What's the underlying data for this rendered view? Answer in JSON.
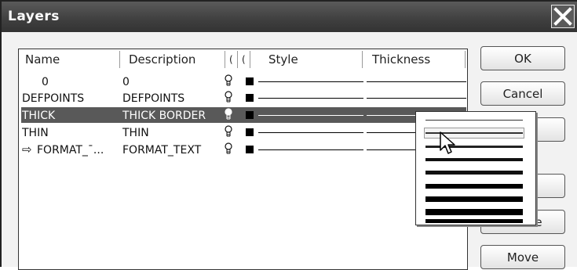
{
  "window": {
    "title": "Layers"
  },
  "columns": {
    "name": "Name",
    "description": "Description",
    "col3": "(",
    "col4": "(",
    "style": "Style",
    "thickness": "Thickness"
  },
  "rows": [
    {
      "name": "0",
      "description": "0",
      "selected": false,
      "current": false
    },
    {
      "name": "DEFPOINTS",
      "description": "DEFPOINTS",
      "selected": false,
      "current": false
    },
    {
      "name": "THICK",
      "description": "THICK BORDER",
      "selected": true,
      "current": false
    },
    {
      "name": "THIN",
      "description": "THIN",
      "selected": false,
      "current": false
    },
    {
      "name": "FORMAT_¯...",
      "description": "FORMAT_TEXT",
      "selected": false,
      "current": true,
      "marker": "⇨"
    }
  ],
  "buttons": {
    "ok": "OK",
    "cancel": "Cancel",
    "btn3": "",
    "btn4": "",
    "delete": "Delete",
    "move": "Move"
  },
  "thickness_popup": {
    "options": [
      "thickness-1",
      "thickness-2",
      "thickness-3",
      "thickness-4",
      "thickness-5",
      "thickness-6",
      "thickness-7",
      "thickness-8",
      "thickness-9"
    ],
    "highlighted_index": 1
  },
  "icons": {
    "close": "close-icon",
    "visibility": "lightbulb-icon",
    "color": "color-swatch-icon",
    "current_layer": "arrow-right-icon",
    "cursor": "mouse-pointer-icon"
  },
  "colors": {
    "titlebar": "#3f3f3f",
    "selection": "#595959"
  }
}
